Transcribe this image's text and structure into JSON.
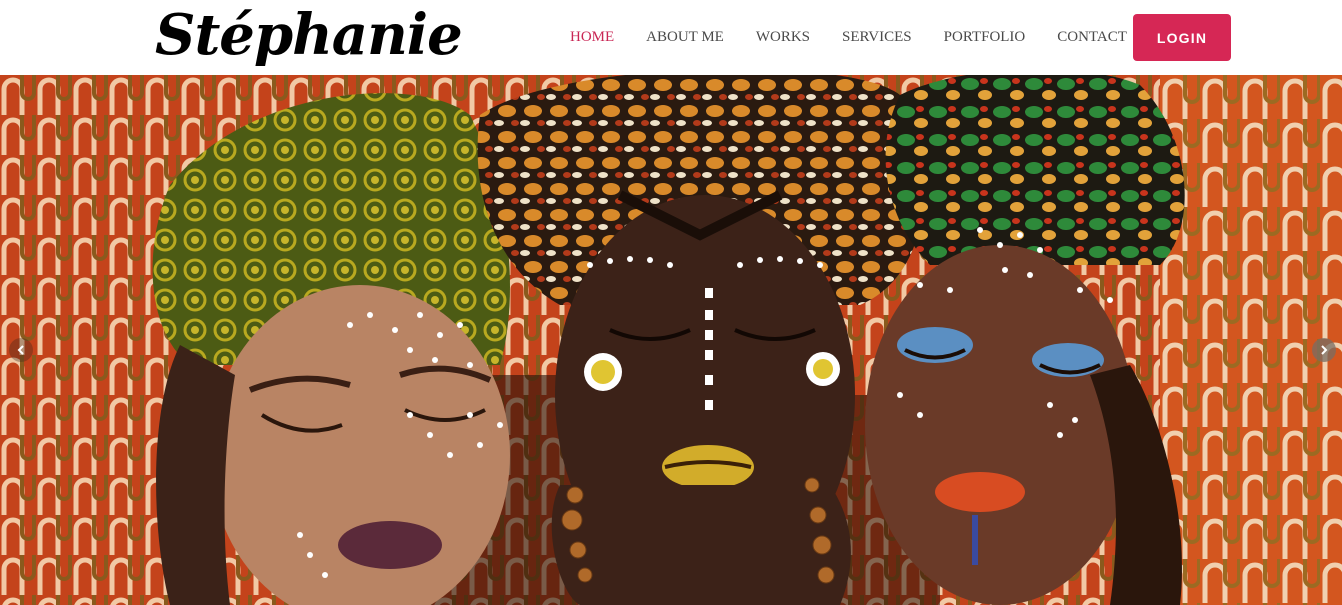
{
  "header": {
    "logo_text": "Stéphanie",
    "nav": [
      {
        "label": "HOME",
        "active": true
      },
      {
        "label": "ABOUT ME",
        "active": false
      },
      {
        "label": "WORKS",
        "active": false
      },
      {
        "label": "SERVICES",
        "active": false
      },
      {
        "label": "PORTFOLIO",
        "active": false
      },
      {
        "label": "CONTACT",
        "active": false
      }
    ],
    "login_label": "LOGIN"
  },
  "hero": {
    "slider_prev_icon": "chevron-left-icon",
    "slider_next_icon": "chevron-right-icon"
  },
  "colors": {
    "accent": "#d62755",
    "nav_active": "#c92654",
    "nav_text": "#4a4a4a"
  }
}
